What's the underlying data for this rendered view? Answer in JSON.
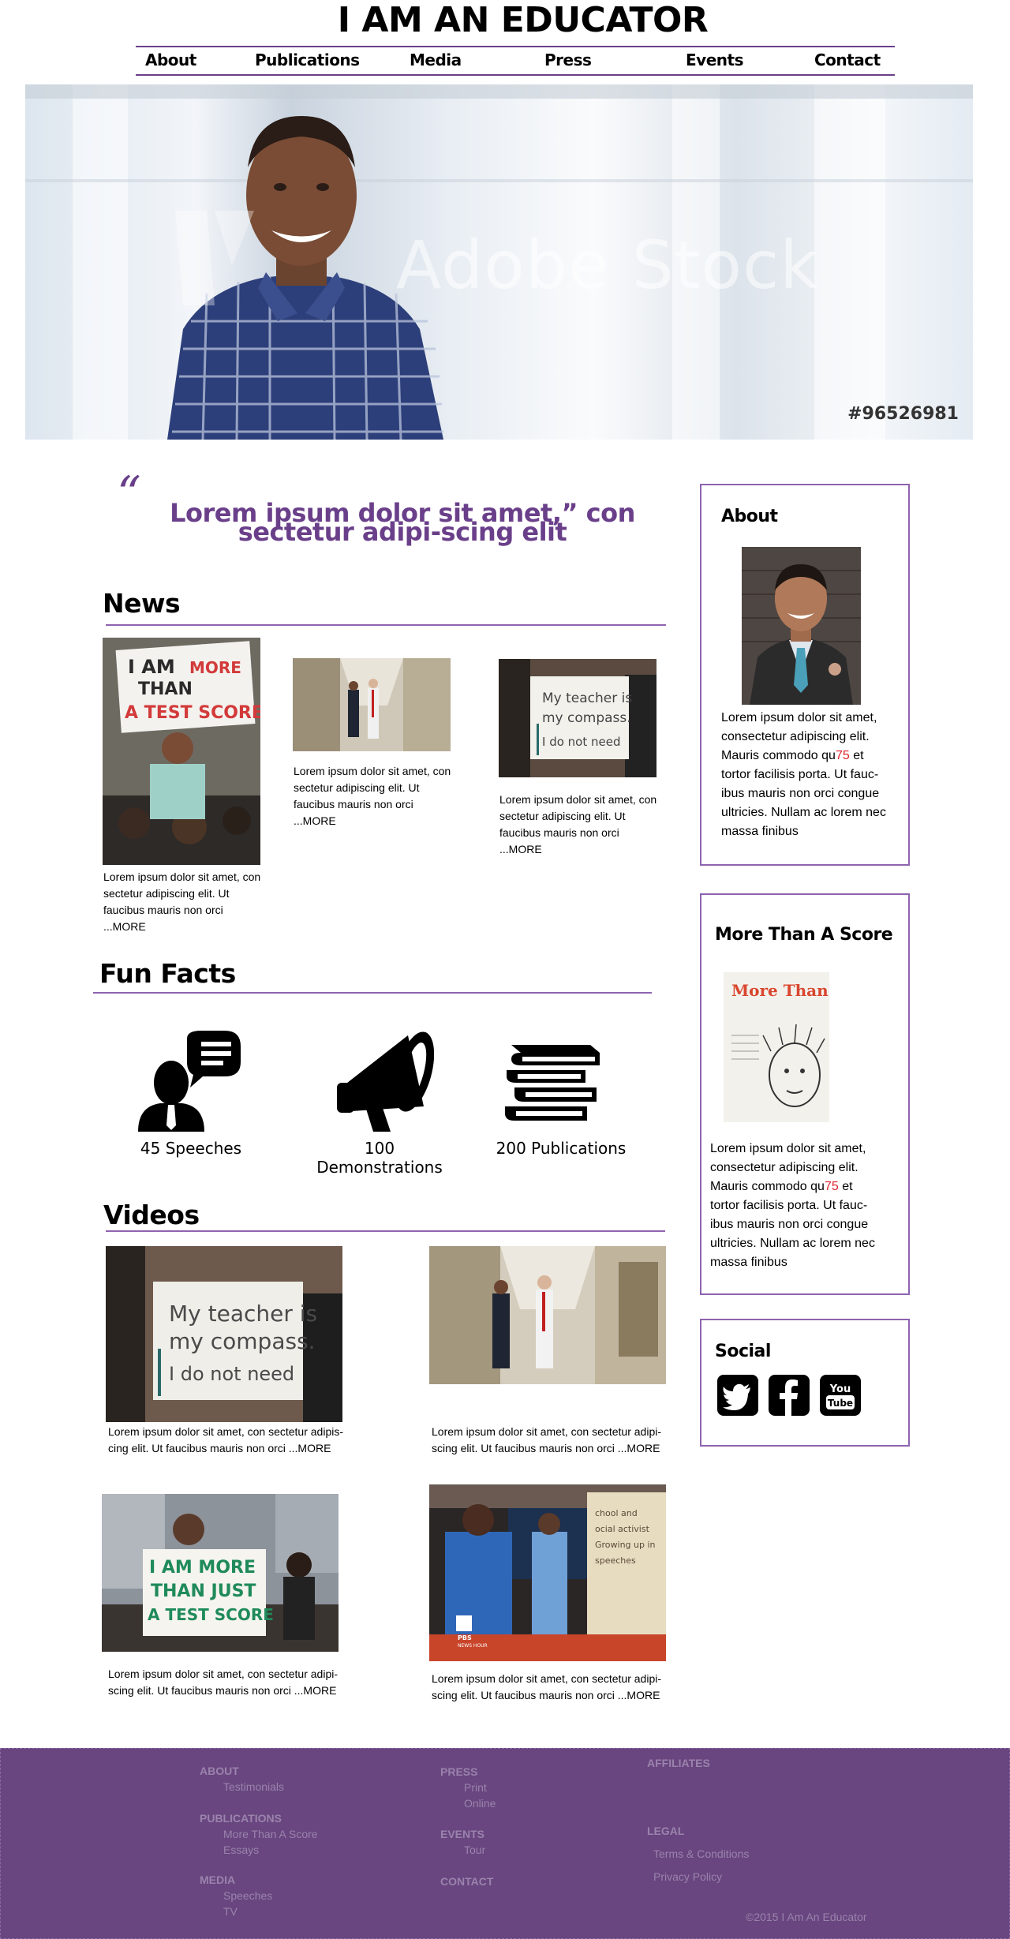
{
  "header": {
    "site_title": "I AM AN EDUCATOR",
    "nav": [
      "About",
      "Publications",
      "Media",
      "Press",
      "Events",
      "Contact"
    ]
  },
  "hero": {
    "watermark": "Adobe Stock",
    "stock_id": "#96526981"
  },
  "quote": {
    "open_mark": "“",
    "text": "Lorem ipsum dolor sit amet,” con sectetur adipi-scing elit"
  },
  "news": {
    "title": "News",
    "items": [
      {
        "text": "Lorem ipsum dolor sit amet, con sectetur adipiscing elit. Ut faucibus mauris non orci",
        "more": "...MORE",
        "photo_sign": "I AM MORE THAN A TEST SCORE"
      },
      {
        "text": "Lorem ipsum dolor sit amet, con sectetur adipiscing elit. Ut faucibus mauris non orci",
        "more": "...MORE"
      },
      {
        "text": "Lorem ipsum dolor sit amet, con sectetur adipiscing elit. Ut faucibus mauris non orci",
        "more": "...MORE",
        "photo_sign": "My teacher is my compass. I do not need"
      }
    ]
  },
  "fun_facts": {
    "title": "Fun Facts",
    "items": [
      {
        "icon": "speaker-icon",
        "label": "45 Speeches"
      },
      {
        "icon": "megaphone-icon",
        "label": "100 Demonstrations"
      },
      {
        "icon": "books-icon",
        "label": "200 Publications"
      }
    ]
  },
  "videos": {
    "title": "Videos",
    "items": [
      {
        "text": "Lorem ipsum dolor sit amet, con sectetur adipis-cing elit. Ut faucibus mauris non orci ...MORE",
        "photo_sign": "My teacher is my compass. I do not need"
      },
      {
        "text": "Lorem ipsum dolor sit amet, con sectetur adipi-scing elit. Ut faucibus mauris non orci ...MORE"
      },
      {
        "text": "Lorem ipsum dolor sit amet, con sectetur adipi-scing elit. Ut faucibus mauris non orci ...MORE",
        "photo_sign": "I AM MORE THAN JUST A TEST SCORE"
      },
      {
        "text": "Lorem ipsum dolor sit amet, con sectetur adipi-scing elit. Ut faucibus mauris non orci ...MORE",
        "photo_sign": "PBS NEWS HOUR"
      }
    ]
  },
  "sidebar": {
    "about": {
      "title": "About",
      "text_before": "Lorem ipsum dolor sit amet, consectetur adipiscing elit. Mauris commodo qu",
      "highlight": "75",
      "text_after": " et tortor facilisis porta. Ut fauc-ibus mauris non orci congue ultricies. Nullam ac lorem nec massa finibus"
    },
    "book": {
      "title": "More Than A Score",
      "cover_title": "More Than a Score",
      "text_before": "Lorem ipsum dolor sit amet, consectetur adipiscing elit. Mauris commodo qu",
      "highlight": "75",
      "text_after": " et tortor facilisis porta. Ut fauc-ibus mauris non orci congue ultricies. Nullam ac lorem nec massa finibus"
    },
    "social": {
      "title": "Social",
      "icons": [
        "twitter-icon",
        "facebook-icon",
        "youtube-icon"
      ],
      "youtube_label": "You Tube"
    }
  },
  "footer": {
    "col1": [
      {
        "head": "ABOUT",
        "items": [
          "Testimonials"
        ]
      },
      {
        "head": "PUBLICATIONS",
        "items": [
          "More Than A Score",
          "Essays"
        ]
      },
      {
        "head": "MEDIA",
        "items": [
          "Speeches",
          "TV"
        ]
      }
    ],
    "col2": [
      {
        "head": "PRESS",
        "items": [
          "Print",
          "Online"
        ]
      },
      {
        "head": "EVENTS",
        "items": [
          "Tour"
        ]
      },
      {
        "head": "CONTACT",
        "items": []
      }
    ],
    "col3": [
      {
        "head": "AFFILIATES",
        "items": []
      },
      {
        "head": "LEGAL",
        "items": [
          "Terms & Conditions",
          "Privacy Policy"
        ]
      }
    ],
    "copyright": "©2015  I Am An Educator"
  },
  "colors": {
    "accent": "#6a3f8a",
    "rule": "#8e63b0",
    "footer_bg": "#69467f",
    "highlight": "#e0242d"
  }
}
